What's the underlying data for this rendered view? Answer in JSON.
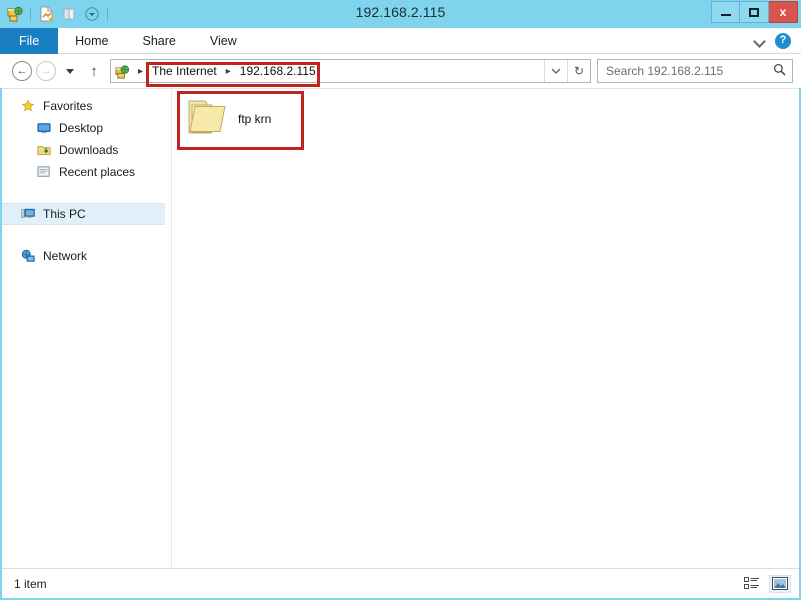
{
  "window": {
    "title": "192.168.2.115",
    "accent_color": "#7fd3ec",
    "close_color": "#d9534f",
    "annotation_color": "#c0241f"
  },
  "quick_access": {
    "items": [
      {
        "name": "explorer-network-icon",
        "label": "Explorer"
      },
      {
        "name": "properties-icon",
        "label": "Properties"
      },
      {
        "name": "new-folder-icon",
        "label": "New folder"
      },
      {
        "name": "customize-dropdown-icon",
        "label": "Customize Quick Access Toolbar"
      }
    ]
  },
  "window_controls": {
    "minimize_label": "Minimize",
    "maximize_label": "Maximize",
    "close_label": "Close",
    "close_glyph": "x"
  },
  "ribbon": {
    "tabs": [
      {
        "label": "File",
        "selected": true
      },
      {
        "label": "Home",
        "selected": false
      },
      {
        "label": "Share",
        "selected": false
      },
      {
        "label": "View",
        "selected": false
      }
    ],
    "expand_label": "Expand the Ribbon",
    "help_label": "?"
  },
  "navigation": {
    "back_label": "Back",
    "back_glyph": "←",
    "forward_label": "Forward",
    "forward_glyph": "→",
    "recent_label": "Recent locations",
    "up_label": "Up",
    "up_glyph": "↑"
  },
  "address": {
    "icon_name": "internet-globe-icon",
    "leading_arrow": "▸",
    "crumbs": [
      {
        "label": "The Internet"
      },
      {
        "label": "192.168.2.115"
      }
    ],
    "separator": "▸",
    "dropdown_label": "Previous locations",
    "refresh_label": "Refresh",
    "refresh_glyph": "↻"
  },
  "search": {
    "placeholder": "Search 192.168.2.115",
    "value": "",
    "icon_glyph": "⌕"
  },
  "sidebar": {
    "items": [
      {
        "label": "Favorites",
        "icon": "star-icon",
        "level": 0,
        "selected": false
      },
      {
        "label": "Desktop",
        "icon": "desktop-monitor-icon",
        "level": 1,
        "selected": false
      },
      {
        "label": "Downloads",
        "icon": "downloads-folder-icon",
        "level": 1,
        "selected": false
      },
      {
        "label": "Recent places",
        "icon": "recent-places-icon",
        "level": 1,
        "selected": false
      }
    ],
    "this_pc": {
      "label": "This PC",
      "icon": "computer-icon",
      "selected": true
    },
    "network": {
      "label": "Network",
      "icon": "network-icon",
      "selected": false
    }
  },
  "content": {
    "items": [
      {
        "label": "ftp krn",
        "type": "folder",
        "icon": "folder-icon"
      }
    ]
  },
  "statusbar": {
    "item_count_text": "1 item",
    "details_view_label": "Details view",
    "large_icons_view_label": "Large icons view"
  }
}
